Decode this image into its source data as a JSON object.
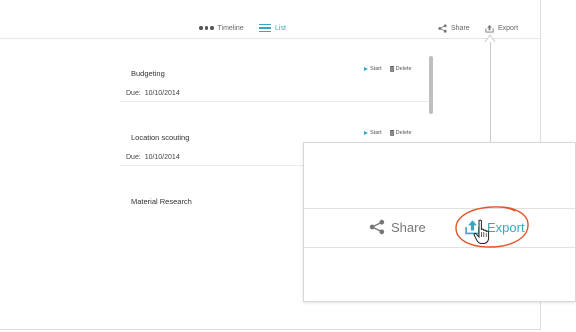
{
  "toolbar": {
    "timeline_label": "Timeline",
    "list_label": "List",
    "share_label": "Share",
    "export_label": "Export"
  },
  "tasks": [
    {
      "title": "Budgeting",
      "due_label": "Due:",
      "due_date": "10/10/2014",
      "start_label": "Start",
      "delete_label": "Delete"
    },
    {
      "title": "Location scouting",
      "due_label": "Due:",
      "due_date": "10/10/2014",
      "start_label": "Start",
      "delete_label": "Delete"
    },
    {
      "title": "Material Research"
    }
  ],
  "zoom": {
    "share_label": "Share",
    "export_label": "Export"
  },
  "colors": {
    "accent": "#3aa7c0",
    "highlight": "#e0572a",
    "muted_text": "#777777"
  }
}
